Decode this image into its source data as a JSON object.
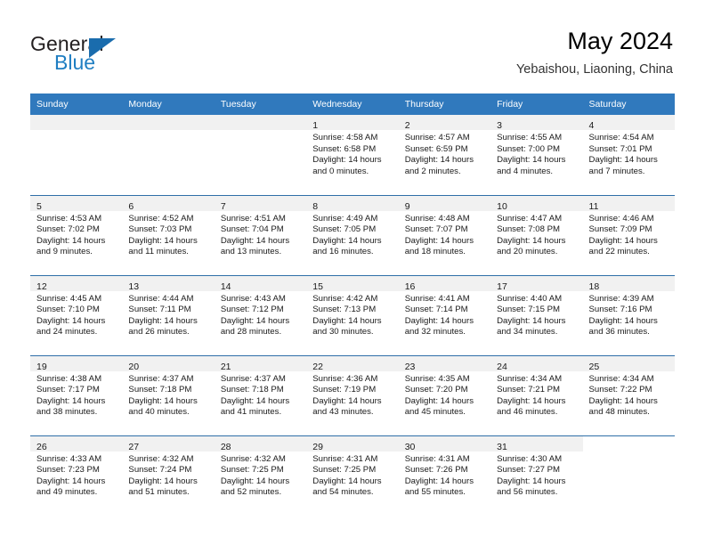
{
  "brand": {
    "name_top": "General",
    "name_bottom": "Blue",
    "triangle_color": "#1a6cad",
    "blue_color": "#1f7ec2"
  },
  "header": {
    "title": "May 2024",
    "subtitle": "Yebaishou, Liaoning, China"
  },
  "theme": {
    "header_bg": "#3079bd",
    "row_border": "#2f6fa8",
    "daynum_bg": "#f1f1f1"
  },
  "weekdays": [
    "Sunday",
    "Monday",
    "Tuesday",
    "Wednesday",
    "Thursday",
    "Friday",
    "Saturday"
  ],
  "weeks": [
    [
      {
        "day": "",
        "sunrise": "",
        "sunset": "",
        "daylight_line1": "",
        "daylight_line2": "",
        "empty": true
      },
      {
        "day": "",
        "sunrise": "",
        "sunset": "",
        "daylight_line1": "",
        "daylight_line2": "",
        "empty": true
      },
      {
        "day": "",
        "sunrise": "",
        "sunset": "",
        "daylight_line1": "",
        "daylight_line2": "",
        "empty": true
      },
      {
        "day": "1",
        "sunrise": "Sunrise: 4:58 AM",
        "sunset": "Sunset: 6:58 PM",
        "daylight_line1": "Daylight: 14 hours",
        "daylight_line2": "and 0 minutes.",
        "empty": false
      },
      {
        "day": "2",
        "sunrise": "Sunrise: 4:57 AM",
        "sunset": "Sunset: 6:59 PM",
        "daylight_line1": "Daylight: 14 hours",
        "daylight_line2": "and 2 minutes.",
        "empty": false
      },
      {
        "day": "3",
        "sunrise": "Sunrise: 4:55 AM",
        "sunset": "Sunset: 7:00 PM",
        "daylight_line1": "Daylight: 14 hours",
        "daylight_line2": "and 4 minutes.",
        "empty": false
      },
      {
        "day": "4",
        "sunrise": "Sunrise: 4:54 AM",
        "sunset": "Sunset: 7:01 PM",
        "daylight_line1": "Daylight: 14 hours",
        "daylight_line2": "and 7 minutes.",
        "empty": false
      }
    ],
    [
      {
        "day": "5",
        "sunrise": "Sunrise: 4:53 AM",
        "sunset": "Sunset: 7:02 PM",
        "daylight_line1": "Daylight: 14 hours",
        "daylight_line2": "and 9 minutes.",
        "empty": false
      },
      {
        "day": "6",
        "sunrise": "Sunrise: 4:52 AM",
        "sunset": "Sunset: 7:03 PM",
        "daylight_line1": "Daylight: 14 hours",
        "daylight_line2": "and 11 minutes.",
        "empty": false
      },
      {
        "day": "7",
        "sunrise": "Sunrise: 4:51 AM",
        "sunset": "Sunset: 7:04 PM",
        "daylight_line1": "Daylight: 14 hours",
        "daylight_line2": "and 13 minutes.",
        "empty": false
      },
      {
        "day": "8",
        "sunrise": "Sunrise: 4:49 AM",
        "sunset": "Sunset: 7:05 PM",
        "daylight_line1": "Daylight: 14 hours",
        "daylight_line2": "and 16 minutes.",
        "empty": false
      },
      {
        "day": "9",
        "sunrise": "Sunrise: 4:48 AM",
        "sunset": "Sunset: 7:07 PM",
        "daylight_line1": "Daylight: 14 hours",
        "daylight_line2": "and 18 minutes.",
        "empty": false
      },
      {
        "day": "10",
        "sunrise": "Sunrise: 4:47 AM",
        "sunset": "Sunset: 7:08 PM",
        "daylight_line1": "Daylight: 14 hours",
        "daylight_line2": "and 20 minutes.",
        "empty": false
      },
      {
        "day": "11",
        "sunrise": "Sunrise: 4:46 AM",
        "sunset": "Sunset: 7:09 PM",
        "daylight_line1": "Daylight: 14 hours",
        "daylight_line2": "and 22 minutes.",
        "empty": false
      }
    ],
    [
      {
        "day": "12",
        "sunrise": "Sunrise: 4:45 AM",
        "sunset": "Sunset: 7:10 PM",
        "daylight_line1": "Daylight: 14 hours",
        "daylight_line2": "and 24 minutes.",
        "empty": false
      },
      {
        "day": "13",
        "sunrise": "Sunrise: 4:44 AM",
        "sunset": "Sunset: 7:11 PM",
        "daylight_line1": "Daylight: 14 hours",
        "daylight_line2": "and 26 minutes.",
        "empty": false
      },
      {
        "day": "14",
        "sunrise": "Sunrise: 4:43 AM",
        "sunset": "Sunset: 7:12 PM",
        "daylight_line1": "Daylight: 14 hours",
        "daylight_line2": "and 28 minutes.",
        "empty": false
      },
      {
        "day": "15",
        "sunrise": "Sunrise: 4:42 AM",
        "sunset": "Sunset: 7:13 PM",
        "daylight_line1": "Daylight: 14 hours",
        "daylight_line2": "and 30 minutes.",
        "empty": false
      },
      {
        "day": "16",
        "sunrise": "Sunrise: 4:41 AM",
        "sunset": "Sunset: 7:14 PM",
        "daylight_line1": "Daylight: 14 hours",
        "daylight_line2": "and 32 minutes.",
        "empty": false
      },
      {
        "day": "17",
        "sunrise": "Sunrise: 4:40 AM",
        "sunset": "Sunset: 7:15 PM",
        "daylight_line1": "Daylight: 14 hours",
        "daylight_line2": "and 34 minutes.",
        "empty": false
      },
      {
        "day": "18",
        "sunrise": "Sunrise: 4:39 AM",
        "sunset": "Sunset: 7:16 PM",
        "daylight_line1": "Daylight: 14 hours",
        "daylight_line2": "and 36 minutes.",
        "empty": false
      }
    ],
    [
      {
        "day": "19",
        "sunrise": "Sunrise: 4:38 AM",
        "sunset": "Sunset: 7:17 PM",
        "daylight_line1": "Daylight: 14 hours",
        "daylight_line2": "and 38 minutes.",
        "empty": false
      },
      {
        "day": "20",
        "sunrise": "Sunrise: 4:37 AM",
        "sunset": "Sunset: 7:18 PM",
        "daylight_line1": "Daylight: 14 hours",
        "daylight_line2": "and 40 minutes.",
        "empty": false
      },
      {
        "day": "21",
        "sunrise": "Sunrise: 4:37 AM",
        "sunset": "Sunset: 7:18 PM",
        "daylight_line1": "Daylight: 14 hours",
        "daylight_line2": "and 41 minutes.",
        "empty": false
      },
      {
        "day": "22",
        "sunrise": "Sunrise: 4:36 AM",
        "sunset": "Sunset: 7:19 PM",
        "daylight_line1": "Daylight: 14 hours",
        "daylight_line2": "and 43 minutes.",
        "empty": false
      },
      {
        "day": "23",
        "sunrise": "Sunrise: 4:35 AM",
        "sunset": "Sunset: 7:20 PM",
        "daylight_line1": "Daylight: 14 hours",
        "daylight_line2": "and 45 minutes.",
        "empty": false
      },
      {
        "day": "24",
        "sunrise": "Sunrise: 4:34 AM",
        "sunset": "Sunset: 7:21 PM",
        "daylight_line1": "Daylight: 14 hours",
        "daylight_line2": "and 46 minutes.",
        "empty": false
      },
      {
        "day": "25",
        "sunrise": "Sunrise: 4:34 AM",
        "sunset": "Sunset: 7:22 PM",
        "daylight_line1": "Daylight: 14 hours",
        "daylight_line2": "and 48 minutes.",
        "empty": false
      }
    ],
    [
      {
        "day": "26",
        "sunrise": "Sunrise: 4:33 AM",
        "sunset": "Sunset: 7:23 PM",
        "daylight_line1": "Daylight: 14 hours",
        "daylight_line2": "and 49 minutes.",
        "empty": false
      },
      {
        "day": "27",
        "sunrise": "Sunrise: 4:32 AM",
        "sunset": "Sunset: 7:24 PM",
        "daylight_line1": "Daylight: 14 hours",
        "daylight_line2": "and 51 minutes.",
        "empty": false
      },
      {
        "day": "28",
        "sunrise": "Sunrise: 4:32 AM",
        "sunset": "Sunset: 7:25 PM",
        "daylight_line1": "Daylight: 14 hours",
        "daylight_line2": "and 52 minutes.",
        "empty": false
      },
      {
        "day": "29",
        "sunrise": "Sunrise: 4:31 AM",
        "sunset": "Sunset: 7:25 PM",
        "daylight_line1": "Daylight: 14 hours",
        "daylight_line2": "and 54 minutes.",
        "empty": false
      },
      {
        "day": "30",
        "sunrise": "Sunrise: 4:31 AM",
        "sunset": "Sunset: 7:26 PM",
        "daylight_line1": "Daylight: 14 hours",
        "daylight_line2": "and 55 minutes.",
        "empty": false
      },
      {
        "day": "31",
        "sunrise": "Sunrise: 4:30 AM",
        "sunset": "Sunset: 7:27 PM",
        "daylight_line1": "Daylight: 14 hours",
        "daylight_line2": "and 56 minutes.",
        "empty": false
      },
      {
        "day": "",
        "sunrise": "",
        "sunset": "",
        "daylight_line1": "",
        "daylight_line2": "",
        "empty": true,
        "no_strip": true
      }
    ]
  ]
}
